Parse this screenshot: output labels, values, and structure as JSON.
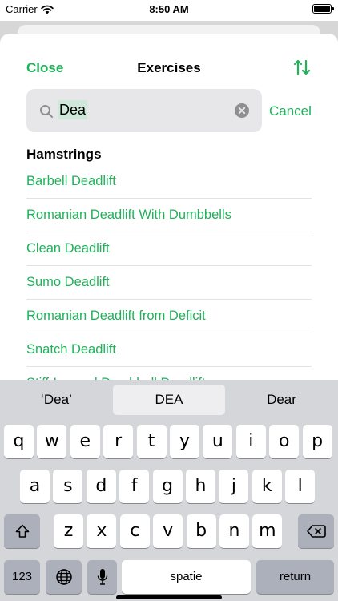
{
  "status_bar": {
    "carrier": "Carrier",
    "time": "8:50 AM"
  },
  "nav": {
    "close_label": "Close",
    "title": "Exercises",
    "sort_icon": "sort-arrows-icon"
  },
  "search": {
    "value": "Dea",
    "cancel_label": "Cancel"
  },
  "section": {
    "title": "Hamstrings"
  },
  "exercises": [
    "Barbell Deadlift",
    "Romanian Deadlift With Dumbbells",
    "Clean Deadlift",
    "Sumo Deadlift",
    "Romanian Deadlift from Deficit",
    "Snatch Deadlift",
    "Stiff-Legged Dumbbell Deadlift"
  ],
  "keyboard": {
    "suggestions": [
      "‘Dea’",
      "DEA",
      "Dear"
    ],
    "row1": [
      "q",
      "w",
      "e",
      "r",
      "t",
      "y",
      "u",
      "i",
      "o",
      "p"
    ],
    "row2": [
      "a",
      "s",
      "d",
      "f",
      "g",
      "h",
      "j",
      "k",
      "l"
    ],
    "row3": [
      "z",
      "x",
      "c",
      "v",
      "b",
      "n",
      "m"
    ],
    "numbers_label": "123",
    "space_label": "spatie",
    "return_label": "return"
  },
  "colors": {
    "accent": "#1fb25a",
    "keyboard_bg": "#d5d6da"
  }
}
